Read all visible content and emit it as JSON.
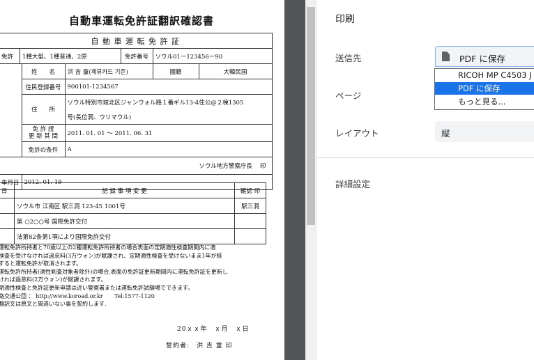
{
  "document": {
    "title": "自動車運転免許証翻訳確認書",
    "license_heading": "自 動 車 運 転 免 許 証",
    "license": {
      "class_label": "免許",
      "class_value": "1種大型、1種普通、2原",
      "number_label": "免許番号",
      "number_value": "ソウル01ー123456ー90",
      "name_label": "姓　　名",
      "name_value": "洪 吉 童(제뮤카드 기준)",
      "nationality_label": "國籍",
      "nationality_value": "大韓民国",
      "reg_label": "住民登録番号",
      "reg_value": "900101-1234567",
      "address_label": "住　　所",
      "address_line1": "ソウル特別市城北区ジャンウォル路１番ギル13-4住公@２棟1305",
      "address_line2": "号(長位洞、ウリマウル)",
      "validity_label_1": "免 許 證",
      "validity_label_2": "更 新 其 間",
      "validity_value": "2011. 01. 01 ～ 2011. 06. 31",
      "conditions_label": "免許の条件",
      "conditions_value": "A",
      "issuer": "ソウル地方警察庁長　 印",
      "issue_label": "年月日",
      "issue_value": "2012. 01. 19"
    },
    "history": {
      "col_date": "日",
      "col_changes": "記 録 事 項 変 更",
      "col_confirm": "確認 印",
      "rows": [
        {
          "text": "ソウル市 江南区 駅三洞 123-45 1001号",
          "seal": "駅三洞"
        },
        {
          "text": "第 ○2○○号 国際免許交付",
          "seal": ""
        },
        {
          "text": "法第82条第1項により国際免許交付",
          "seal": ""
        }
      ]
    },
    "notes": [
      "運転免許所持者と70歳以上の2種運転免許所持者の場合表面の定期適性検査期間内に適",
      "検査を受けなければ過怠料(3万ウォン)が賦課され、定期適性検査を受けないまま1年が経",
      "すると運転免許が取消されます。",
      "運転免許所持者(適性剣査対象者除外)の場合,表面の免許証更新期間内に運転免許証を更新し",
      "ければ過怠料(2万ウォン)が賦課されます。",
      "期適性検査と免許証更新申請は近い警察署または運転免許試験場でできます。",
      "路交通公団 ： http://www.koroad.or.kr　　Tel:1577-1120",
      "翻訳文は原文と間違いない事を誓約します."
    ],
    "sign_date": "20ｘｘ年　ｘ月　ｘ日",
    "signer": "誓約者:　洪 吉 童 印"
  },
  "settings": {
    "title": "印刷",
    "destination_label": "送信先",
    "destination_value": "PDF に保存",
    "destination_options": [
      "RICOH MP C4503 J",
      "PDF に保存",
      "もっと見る..."
    ],
    "pages_label": "ページ",
    "layout_label": "レイアウト",
    "layout_value": "縦",
    "more_settings_label": "詳細設定"
  },
  "colors": {
    "accent": "#1a73e8",
    "preview_bg": "#525659",
    "field_bg": "#f1f3f4"
  },
  "icons": {
    "pdf": "file-document-icon"
  }
}
